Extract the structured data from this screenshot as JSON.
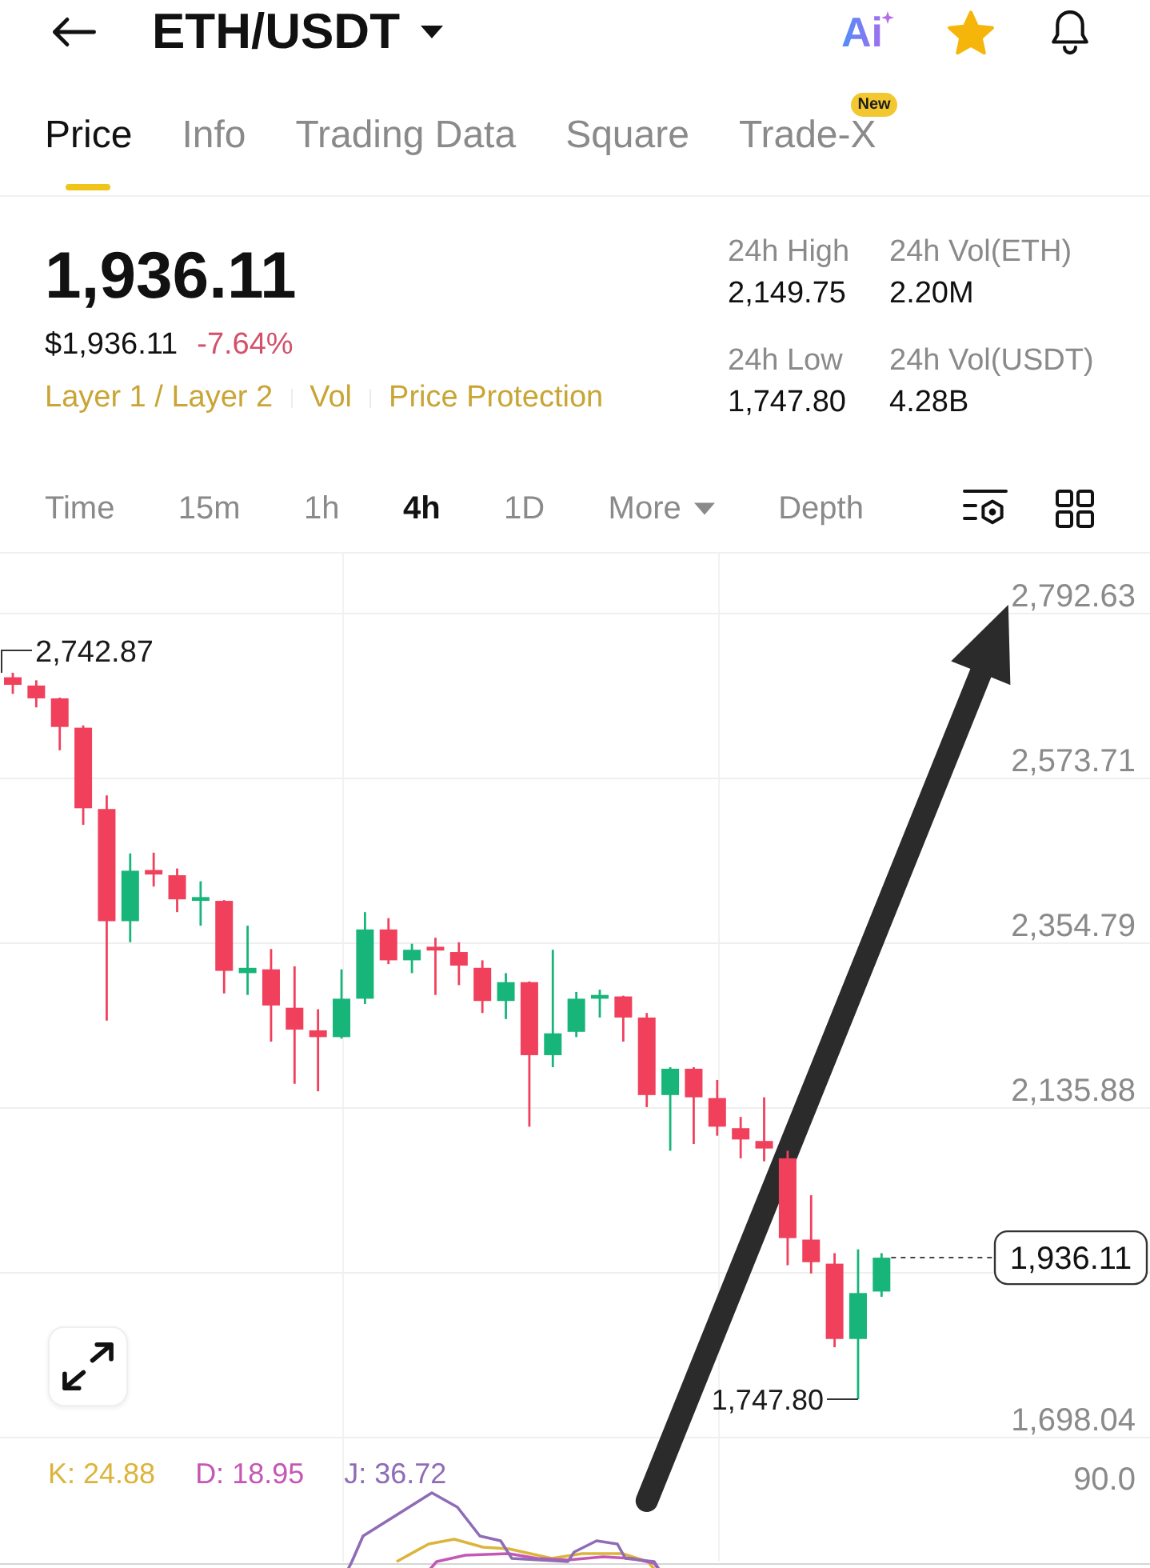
{
  "header": {
    "title": "ETH/USDT",
    "ai_label": "Ai",
    "favorite": true
  },
  "tabs": [
    {
      "label": "Price",
      "selected": true
    },
    {
      "label": "Info",
      "selected": false
    },
    {
      "label": "Trading Data",
      "selected": false
    },
    {
      "label": "Square",
      "selected": false
    },
    {
      "label": "Trade-X",
      "selected": false,
      "badge": "New"
    }
  ],
  "ticker": {
    "price": "1,936.11",
    "usd_price": "$1,936.11",
    "change": "-7.64%",
    "falling": true,
    "tags": [
      "Layer 1 / Layer 2",
      "Vol",
      "Price Protection"
    ],
    "stats": [
      {
        "label": "24h High",
        "value": "2,149.75"
      },
      {
        "label": "24h Vol(ETH)",
        "value": "2.20M"
      },
      {
        "label": "24h Low",
        "value": "1,747.80"
      },
      {
        "label": "24h Vol(USDT)",
        "value": "4.28B"
      }
    ]
  },
  "intervals": [
    {
      "label": "Time",
      "selected": false
    },
    {
      "label": "15m",
      "selected": false
    },
    {
      "label": "1h",
      "selected": false
    },
    {
      "label": "4h",
      "selected": true
    },
    {
      "label": "1D",
      "selected": false
    },
    {
      "label": "More",
      "selected": false,
      "kind": "dropdown"
    },
    {
      "label": "Depth",
      "selected": false
    }
  ],
  "chart": {
    "chart_data": {
      "type": "candlestick",
      "grid": true,
      "ohlc": [
        [
          2707,
          2713,
          2685,
          2697
        ],
        [
          2696,
          2703,
          2667,
          2679
        ],
        [
          2679,
          2680,
          2610,
          2641
        ],
        [
          2640,
          2643,
          2511,
          2533
        ],
        [
          2532,
          2550,
          2251,
          2383
        ],
        [
          2383,
          2473,
          2355,
          2450
        ],
        [
          2451,
          2474,
          2429,
          2445
        ],
        [
          2444,
          2453,
          2395,
          2412
        ],
        [
          2410,
          2436,
          2377,
          2415
        ],
        [
          2410,
          2411,
          2287,
          2317
        ],
        [
          2314,
          2377,
          2285,
          2321
        ],
        [
          2319,
          2346,
          2223,
          2271
        ],
        [
          2268,
          2323,
          2167,
          2239
        ],
        [
          2238,
          2266,
          2157,
          2229
        ],
        [
          2229,
          2319,
          2227,
          2280
        ],
        [
          2280,
          2395,
          2273,
          2372
        ],
        [
          2372,
          2387,
          2326,
          2331
        ],
        [
          2331,
          2353,
          2314,
          2345
        ],
        [
          2349,
          2361,
          2285,
          2344
        ],
        [
          2342,
          2355,
          2298,
          2324
        ],
        [
          2321,
          2331,
          2261,
          2277
        ],
        [
          2277,
          2314,
          2253,
          2302
        ],
        [
          2302,
          2303,
          2110,
          2205
        ],
        [
          2205,
          2345,
          2189,
          2234
        ],
        [
          2236,
          2289,
          2229,
          2280
        ],
        [
          2280,
          2292,
          2255,
          2285
        ],
        [
          2283,
          2284,
          2223,
          2255
        ],
        [
          2255,
          2261,
          2136,
          2152
        ],
        [
          2152,
          2189,
          2078,
          2187
        ],
        [
          2187,
          2189,
          2087,
          2149
        ],
        [
          2148,
          2172,
          2098,
          2110
        ],
        [
          2108,
          2123,
          2068,
          2093
        ],
        [
          2091,
          2149,
          2064,
          2081
        ],
        [
          2068,
          2078,
          1926,
          1962
        ],
        [
          1960,
          2019,
          1915,
          1930
        ],
        [
          1928,
          1942,
          1817,
          1828
        ],
        [
          1828,
          1947,
          1748,
          1889
        ],
        [
          1891,
          1942,
          1884,
          1936
        ]
      ],
      "ylim": [
        1698.04,
        2873.4
      ],
      "yticks": [
        {
          "value": 2792.63,
          "label": "2,792.63"
        },
        {
          "value": 2573.71,
          "label": "2,573.71"
        },
        {
          "value": 2354.79,
          "label": "2,354.79"
        },
        {
          "value": 2135.88,
          "label": "2,135.88"
        },
        {
          "value": 1698.04,
          "label": "1,698.04"
        }
      ]
    },
    "high_marker": "2,742.87",
    "low_marker": "1,747.80",
    "last_price_tag": "1,936.11"
  },
  "indicator": {
    "items": [
      {
        "label": "K: 24.88",
        "color": "#dcb43c"
      },
      {
        "label": "D: 18.95",
        "color": "#c458b4"
      },
      {
        "label": "J: 36.72",
        "color": "#8f6cb5"
      }
    ],
    "scale_label": "90.0"
  }
}
